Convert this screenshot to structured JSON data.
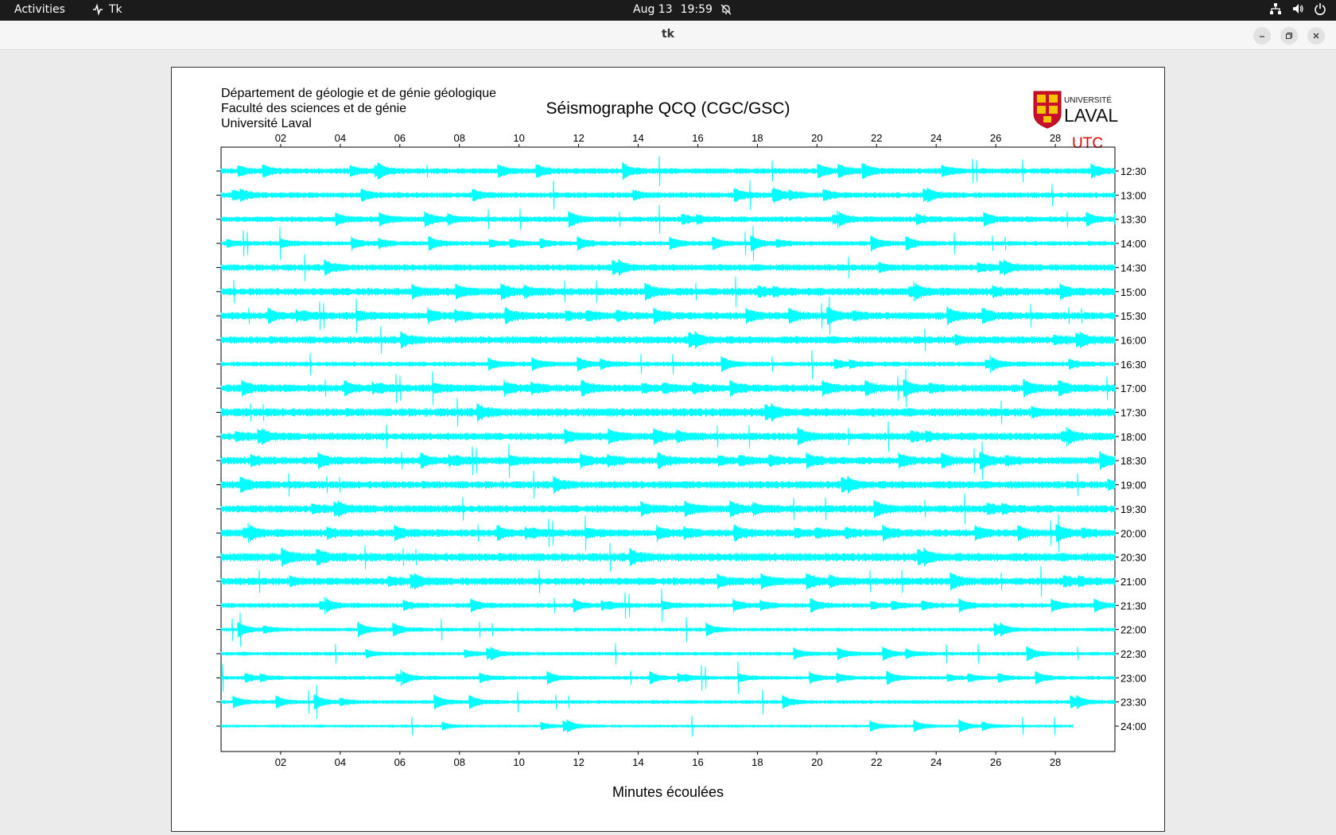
{
  "topbar": {
    "activities": "Activities",
    "app_name": "Tk",
    "date": "Aug 13",
    "time": "19:59"
  },
  "window": {
    "title": "tk"
  },
  "seismograph": {
    "header_lines": [
      "Département de géologie et de génie géologique",
      "Faculté des sciences et de génie",
      "Université Laval"
    ],
    "title": "Séismographe QCQ (CGC/GSC)",
    "logo_text_top": "UNIVERSITÉ",
    "logo_text_bottom": "LAVAL",
    "utc_label": "UTC",
    "xlabel": "Minutes écoulées"
  },
  "chart_data": {
    "type": "line",
    "title": "Séismographe QCQ (CGC/GSC)",
    "xlabel": "Minutes écoulées",
    "ylabel": "UTC",
    "xlim": [
      0,
      30
    ],
    "x_ticks": [
      "02",
      "04",
      "06",
      "08",
      "10",
      "12",
      "14",
      "16",
      "18",
      "20",
      "22",
      "24",
      "26",
      "28"
    ],
    "x_tick_values": [
      2,
      4,
      6,
      8,
      10,
      12,
      14,
      16,
      18,
      20,
      22,
      24,
      26,
      28
    ],
    "trace_color": "#00ffff",
    "rows": [
      {
        "label": "12:30",
        "amp": 3
      },
      {
        "label": "13:00",
        "amp": 3
      },
      {
        "label": "13:30",
        "amp": 3
      },
      {
        "label": "14:00",
        "amp": 2.5
      },
      {
        "label": "14:30",
        "amp": 3.5
      },
      {
        "label": "15:00",
        "amp": 4
      },
      {
        "label": "15:30",
        "amp": 4
      },
      {
        "label": "16:00",
        "amp": 4
      },
      {
        "label": "16:30",
        "amp": 2.5
      },
      {
        "label": "17:00",
        "amp": 4
      },
      {
        "label": "17:30",
        "amp": 4.5
      },
      {
        "label": "18:00",
        "amp": 4
      },
      {
        "label": "18:30",
        "amp": 4
      },
      {
        "label": "19:00",
        "amp": 4
      },
      {
        "label": "19:30",
        "amp": 4
      },
      {
        "label": "20:00",
        "amp": 4
      },
      {
        "label": "20:30",
        "amp": 4.5
      },
      {
        "label": "21:00",
        "amp": 4
      },
      {
        "label": "21:30",
        "amp": 2.5
      },
      {
        "label": "22:00",
        "amp": 2
      },
      {
        "label": "22:30",
        "amp": 2
      },
      {
        "label": "23:00",
        "amp": 2
      },
      {
        "label": "23:30",
        "amp": 2
      },
      {
        "label": "24:00",
        "amp": 1.5,
        "end_minute": 28.6
      }
    ]
  },
  "colors": {
    "utc_label": "#dd0000",
    "trace": "#00ffff",
    "topbar": "#1b1b1b"
  }
}
